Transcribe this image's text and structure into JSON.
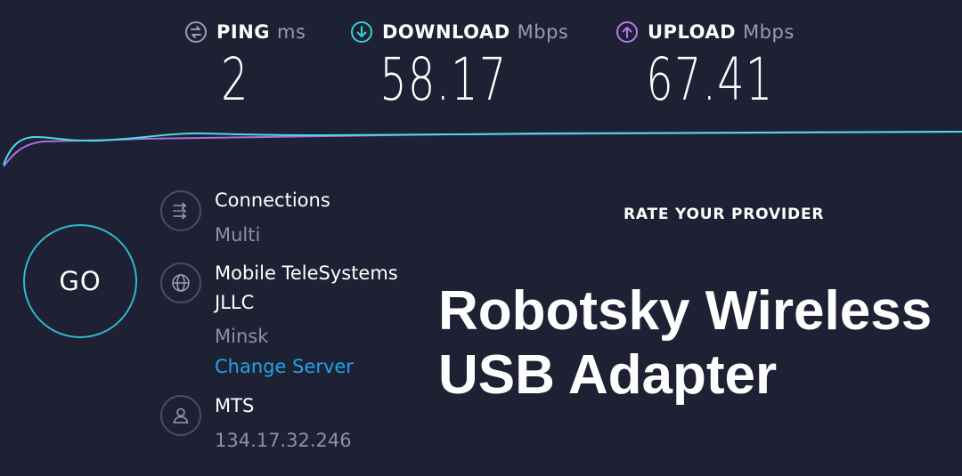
{
  "metrics": {
    "ping": {
      "label": "PING",
      "unit": "ms",
      "value": "2",
      "icon": "ping-icon",
      "icon_color": "#9a9bb4"
    },
    "download": {
      "label": "DOWNLOAD",
      "unit": "Mbps",
      "value": "58.17",
      "icon": "download-arrow-icon",
      "icon_color": "#2fd3d6"
    },
    "upload": {
      "label": "UPLOAD",
      "unit": "Mbps",
      "value": "67.41",
      "icon": "upload-arrow-icon",
      "icon_color": "#b57ae8"
    }
  },
  "graph": {
    "download_color": "#49dde0",
    "upload_color": "#a86ee8"
  },
  "go_button": {
    "label": "GO",
    "ring_color": "#2fb9cc"
  },
  "connections": {
    "title": "Connections",
    "value": "Multi",
    "icon": "connections-icon"
  },
  "server": {
    "name_line1": "Mobile TeleSystems",
    "name_line2": "JLLC",
    "city": "Minsk",
    "change_label": "Change Server",
    "icon": "globe-icon",
    "link_color": "#1ea6e6"
  },
  "isp": {
    "name": "MTS",
    "ip": "134.17.32.246",
    "icon": "user-icon"
  },
  "rate_provider": {
    "label": "RATE YOUR PROVIDER"
  },
  "overlay_caption": {
    "line1": "Robotsky Wireless",
    "line2": "USB Adapter"
  }
}
